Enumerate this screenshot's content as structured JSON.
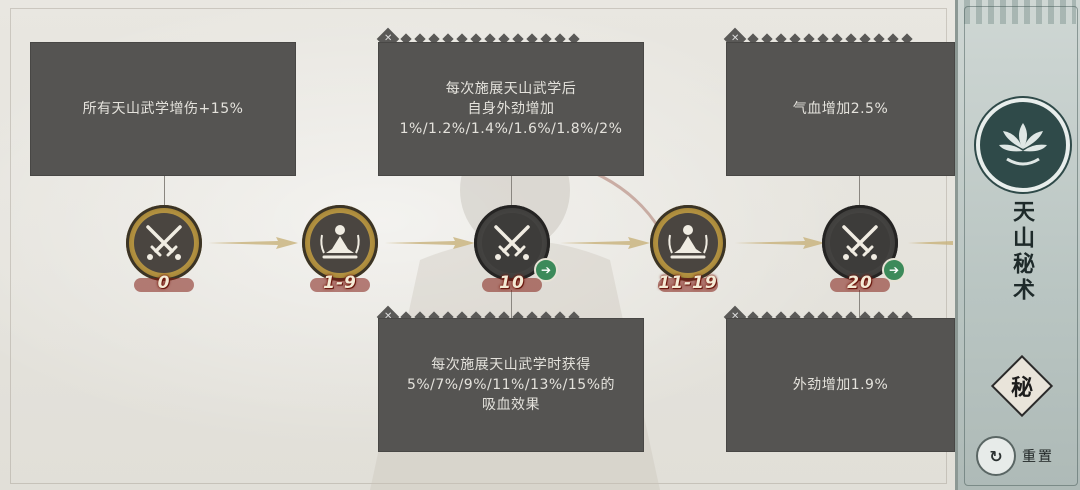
{
  "cards": [
    {
      "id": "top-1",
      "text": "所有天山武学增伤+15%"
    },
    {
      "id": "top-2",
      "text": "每次施展天山武学后\n自身外劲增加\n1%/1.2%/1.4%/1.6%/1.8%/2%"
    },
    {
      "id": "top-3",
      "text": "气血增加2.5%"
    },
    {
      "id": "bottom-1",
      "text": "每次施展天山武学时获得\n5%/7%/9%/11%/13%/15%的\n吸血效果"
    },
    {
      "id": "bottom-2",
      "text": "外劲增加1.9%"
    }
  ],
  "nodes": [
    {
      "label": "0",
      "icon": "crossed-swords-icon",
      "state": "active"
    },
    {
      "label": "1-9",
      "icon": "meditation-icon",
      "state": "active"
    },
    {
      "label": "10",
      "icon": "crossed-swords-icon",
      "state": "inactive",
      "badge": "➔"
    },
    {
      "label": "11-19",
      "icon": "meditation-icon",
      "state": "active"
    },
    {
      "label": "20",
      "icon": "crossed-swords-icon",
      "state": "inactive",
      "badge": "➔"
    }
  ],
  "sidebar": {
    "title": "天山秘术",
    "seal": "秘",
    "reset_label": "重置",
    "reset_icon": "reset-icon"
  },
  "colors": {
    "card_bg": "#555452",
    "gold": "#b08f3e",
    "badge_green": "#3c8a5a",
    "sidebar_teal": "#2f4a49"
  }
}
